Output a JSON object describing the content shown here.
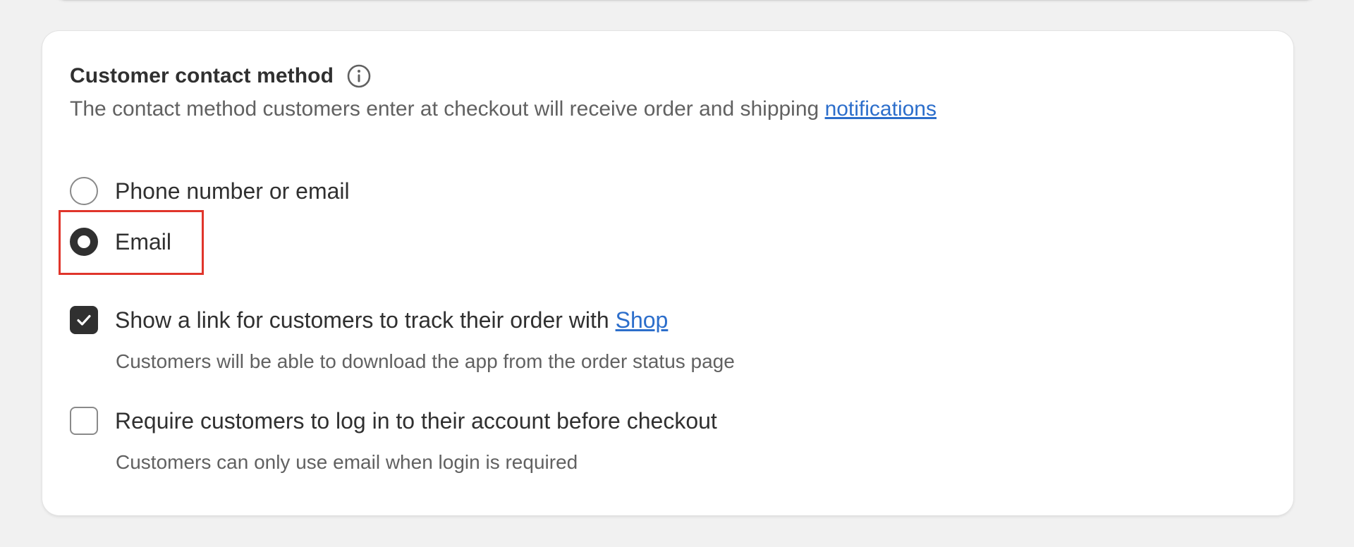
{
  "section": {
    "title": "Customer contact method",
    "info_icon": "info-icon",
    "description": "The contact method customers enter at checkout will receive order and shipping ",
    "description_link": "notifications"
  },
  "contact_options": [
    {
      "label": "Phone number or email",
      "selected": false
    },
    {
      "label": "Email",
      "selected": true
    }
  ],
  "shop_link_setting": {
    "label": "Show a link for customers to track their order with ",
    "link": "Shop",
    "checked": true,
    "help": "Customers will be able to download the app from the order status page"
  },
  "login_setting": {
    "label": "Require customers to log in to their account before checkout",
    "checked": false,
    "help": "Customers can only use email when login is required"
  },
  "colors": {
    "accent_link": "#2c6ecb",
    "highlight": "#e0352b",
    "checked_fill": "#303030"
  }
}
